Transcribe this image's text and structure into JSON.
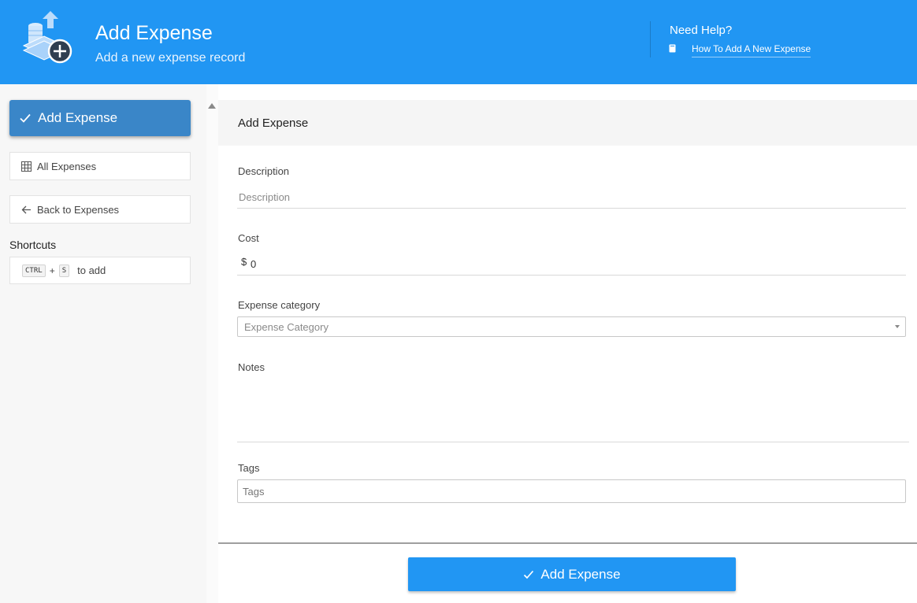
{
  "header": {
    "title": "Add Expense",
    "subtitle": "Add a new expense record",
    "help_title": "Need Help?",
    "help_link": "How To Add A New Expense"
  },
  "sidebar": {
    "primary_button": "Add Expense",
    "items": [
      {
        "label": "All Expenses",
        "icon": "grid-icon"
      },
      {
        "label": "Back to Expenses",
        "icon": "arrow-left-icon"
      }
    ],
    "shortcuts_title": "Shortcuts",
    "shortcut": {
      "key1": "CTRL",
      "plus": "+",
      "key2": "S",
      "action": "to add"
    }
  },
  "form": {
    "panel_title": "Add Expense",
    "description": {
      "label": "Description",
      "placeholder": "Description",
      "value": ""
    },
    "cost": {
      "label": "Cost",
      "prefix": "$",
      "value": "0"
    },
    "category": {
      "label": "Expense category",
      "placeholder": "Expense Category"
    },
    "notes": {
      "label": "Notes",
      "value": ""
    },
    "tags": {
      "label": "Tags",
      "placeholder": "Tags"
    },
    "submit_label": "Add Expense"
  },
  "colors": {
    "brand": "#2196f3",
    "sidebar_primary": "#3a86c8",
    "sidebar_bg": "#f7f7f7"
  }
}
